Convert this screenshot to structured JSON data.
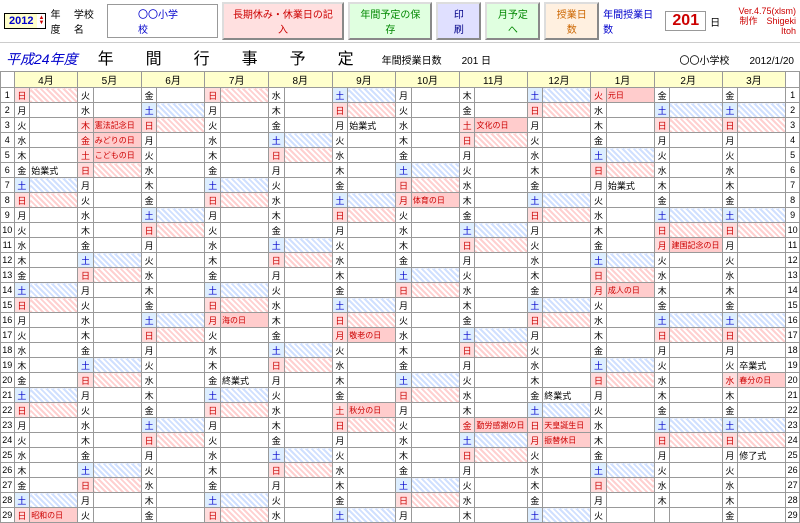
{
  "toolbar": {
    "year": "2012",
    "year_suffix": "年度",
    "school_lbl": "学校名",
    "school": "〇〇小学校",
    "b1": "長期休み・休業日の記入",
    "b2": "年間予定の保存",
    "b3": "印　刷",
    "b4": "月予定へ",
    "b5": "授業日数",
    "days_lbl": "年間授業日数",
    "days": "201",
    "days_unit": "日"
  },
  "ver": {
    "v": "Ver.4.75(xlsm)",
    "author": "制作　Shigeki Itoh"
  },
  "title": {
    "era": "平成24年度",
    "main": "年　間　行　事　予　定",
    "sub_lbl": "年間授業日数",
    "sub_val": "201 日",
    "school": "〇〇小学校",
    "date": "2012/1/20"
  },
  "months": [
    "4月",
    "5月",
    "6月",
    "7月",
    "8月",
    "9月",
    "10月",
    "11月",
    "12月",
    "1月",
    "2月",
    "3月"
  ],
  "dow_chars": {
    "sun": "日",
    "mon": "月",
    "tue": "火",
    "wed": "水",
    "thu": "木",
    "fri": "金",
    "sat": "土"
  },
  "events": {
    "shigyou": "始業式",
    "shuugyou": "終業式",
    "sotsugyou": "卒業式",
    "shuuryou": "修了式",
    "kenpou": "憲法記念日",
    "midori": "みどりの日",
    "kodomo": "こどもの日",
    "showa": "昭和の日",
    "umi": "海の日",
    "keirou": "敬老の日",
    "shuubun": "秋分の日",
    "taiiku": "体育の日",
    "bunka": "文化の日",
    "kinrou": "勤労感謝の日",
    "tennou": "天皇誕生日",
    "furikae": "振替休日",
    "gantan": "元日",
    "seijin": "成人の日",
    "kenkoku": "建国記念の日",
    "shunbun": "春分の日"
  },
  "cal": [
    [
      [
        "日",
        "s"
      ],
      [
        "火"
      ],
      [
        "金"
      ],
      [
        "日",
        "s"
      ],
      [
        "水"
      ],
      [
        "土",
        "b"
      ],
      [
        "月"
      ],
      [
        "木"
      ],
      [
        "土",
        "b"
      ],
      [
        "火",
        "h",
        "gantan"
      ],
      [
        "金"
      ],
      [
        "金"
      ]
    ],
    [
      [
        "月"
      ],
      [
        "水"
      ],
      [
        "土",
        "b"
      ],
      [
        "月"
      ],
      [
        "木"
      ],
      [
        "日",
        "s"
      ],
      [
        "火"
      ],
      [
        "金"
      ],
      [
        "日",
        "s"
      ],
      [
        "水"
      ],
      [
        "土",
        "b"
      ],
      [
        "土",
        "b"
      ]
    ],
    [
      [
        "火"
      ],
      [
        "木",
        "h",
        "kenpou"
      ],
      [
        "日",
        "s"
      ],
      [
        "火"
      ],
      [
        "金"
      ],
      [
        "月",
        "",
        "shigyou"
      ],
      [
        "水"
      ],
      [
        "土",
        "h",
        "bunka"
      ],
      [
        "月"
      ],
      [
        "木"
      ],
      [
        "日",
        "s"
      ],
      [
        "日",
        "s"
      ]
    ],
    [
      [
        "水"
      ],
      [
        "金",
        "h",
        "midori"
      ],
      [
        "月"
      ],
      [
        "水"
      ],
      [
        "土",
        "b"
      ],
      [
        "火"
      ],
      [
        "木"
      ],
      [
        "日",
        "s"
      ],
      [
        "火"
      ],
      [
        "金"
      ],
      [
        "月"
      ],
      [
        "月"
      ]
    ],
    [
      [
        "木"
      ],
      [
        "土",
        "h",
        "kodomo"
      ],
      [
        "火"
      ],
      [
        "木"
      ],
      [
        "日",
        "s"
      ],
      [
        "水"
      ],
      [
        "金"
      ],
      [
        "月"
      ],
      [
        "水"
      ],
      [
        "土",
        "b"
      ],
      [
        "火"
      ],
      [
        "火"
      ]
    ],
    [
      [
        "金",
        "",
        "shigyou"
      ],
      [
        "日",
        "s"
      ],
      [
        "水"
      ],
      [
        "金"
      ],
      [
        "月"
      ],
      [
        "木"
      ],
      [
        "土",
        "b"
      ],
      [
        "火"
      ],
      [
        "木"
      ],
      [
        "日",
        "s"
      ],
      [
        "水"
      ],
      [
        "水"
      ]
    ],
    [
      [
        "土",
        "b"
      ],
      [
        "月"
      ],
      [
        "木"
      ],
      [
        "土",
        "b"
      ],
      [
        "火"
      ],
      [
        "金"
      ],
      [
        "日",
        "s"
      ],
      [
        "水"
      ],
      [
        "金"
      ],
      [
        "月",
        "",
        "shigyou"
      ],
      [
        "木"
      ],
      [
        "木"
      ]
    ],
    [
      [
        "日",
        "s"
      ],
      [
        "火"
      ],
      [
        "金"
      ],
      [
        "日",
        "s"
      ],
      [
        "水"
      ],
      [
        "土",
        "b"
      ],
      [
        "月",
        "h",
        "taiiku"
      ],
      [
        "木"
      ],
      [
        "土",
        "b"
      ],
      [
        "火"
      ],
      [
        "金"
      ],
      [
        "金"
      ]
    ],
    [
      [
        "月"
      ],
      [
        "水"
      ],
      [
        "土",
        "b"
      ],
      [
        "月"
      ],
      [
        "木"
      ],
      [
        "日",
        "s"
      ],
      [
        "火"
      ],
      [
        "金"
      ],
      [
        "日",
        "s"
      ],
      [
        "水"
      ],
      [
        "土",
        "b"
      ],
      [
        "土",
        "b"
      ]
    ],
    [
      [
        "火"
      ],
      [
        "木"
      ],
      [
        "日",
        "s"
      ],
      [
        "火"
      ],
      [
        "金"
      ],
      [
        "月"
      ],
      [
        "水"
      ],
      [
        "土",
        "b"
      ],
      [
        "月"
      ],
      [
        "木"
      ],
      [
        "日",
        "s"
      ],
      [
        "日",
        "s"
      ]
    ],
    [
      [
        "水"
      ],
      [
        "金"
      ],
      [
        "月"
      ],
      [
        "水"
      ],
      [
        "土",
        "b"
      ],
      [
        "火"
      ],
      [
        "木"
      ],
      [
        "日",
        "s"
      ],
      [
        "火"
      ],
      [
        "金"
      ],
      [
        "月",
        "h",
        "kenkoku"
      ],
      [
        "月"
      ]
    ],
    [
      [
        "木"
      ],
      [
        "土",
        "b"
      ],
      [
        "火"
      ],
      [
        "木"
      ],
      [
        "日",
        "s"
      ],
      [
        "水"
      ],
      [
        "金"
      ],
      [
        "月"
      ],
      [
        "水"
      ],
      [
        "土",
        "b"
      ],
      [
        "火"
      ],
      [
        "火"
      ]
    ],
    [
      [
        "金"
      ],
      [
        "日",
        "s"
      ],
      [
        "水"
      ],
      [
        "金"
      ],
      [
        "月"
      ],
      [
        "木"
      ],
      [
        "土",
        "b"
      ],
      [
        "火"
      ],
      [
        "木"
      ],
      [
        "日",
        "s"
      ],
      [
        "水"
      ],
      [
        "水"
      ]
    ],
    [
      [
        "土",
        "b"
      ],
      [
        "月"
      ],
      [
        "木"
      ],
      [
        "土",
        "b"
      ],
      [
        "火"
      ],
      [
        "金"
      ],
      [
        "日",
        "s"
      ],
      [
        "水"
      ],
      [
        "金"
      ],
      [
        "月",
        "h",
        "seijin"
      ],
      [
        "木"
      ],
      [
        "木"
      ]
    ],
    [
      [
        "日",
        "s"
      ],
      [
        "火"
      ],
      [
        "金"
      ],
      [
        "日",
        "s"
      ],
      [
        "水"
      ],
      [
        "土",
        "b"
      ],
      [
        "月"
      ],
      [
        "木"
      ],
      [
        "土",
        "b"
      ],
      [
        "火"
      ],
      [
        "金"
      ],
      [
        "金"
      ]
    ],
    [
      [
        "月"
      ],
      [
        "水"
      ],
      [
        "土",
        "b"
      ],
      [
        "月",
        "h",
        "umi"
      ],
      [
        "木"
      ],
      [
        "日",
        "s"
      ],
      [
        "火"
      ],
      [
        "金"
      ],
      [
        "日",
        "s"
      ],
      [
        "水"
      ],
      [
        "土",
        "b"
      ],
      [
        "土",
        "b"
      ]
    ],
    [
      [
        "火"
      ],
      [
        "木"
      ],
      [
        "日",
        "s"
      ],
      [
        "火"
      ],
      [
        "金"
      ],
      [
        "月",
        "h",
        "keirou"
      ],
      [
        "水"
      ],
      [
        "土",
        "b"
      ],
      [
        "月"
      ],
      [
        "木"
      ],
      [
        "日",
        "s"
      ],
      [
        "日",
        "s"
      ]
    ],
    [
      [
        "水"
      ],
      [
        "金"
      ],
      [
        "月"
      ],
      [
        "水"
      ],
      [
        "土",
        "b"
      ],
      [
        "火"
      ],
      [
        "木"
      ],
      [
        "日",
        "s"
      ],
      [
        "火"
      ],
      [
        "金"
      ],
      [
        "月"
      ],
      [
        "月"
      ]
    ],
    [
      [
        "木"
      ],
      [
        "土",
        "b"
      ],
      [
        "火"
      ],
      [
        "木"
      ],
      [
        "日",
        "s"
      ],
      [
        "水"
      ],
      [
        "金"
      ],
      [
        "月"
      ],
      [
        "水"
      ],
      [
        "土",
        "b"
      ],
      [
        "火"
      ],
      [
        "火",
        "",
        "sotsugyou"
      ]
    ],
    [
      [
        "金"
      ],
      [
        "日",
        "s"
      ],
      [
        "水"
      ],
      [
        "金",
        "",
        "shuugyou"
      ],
      [
        "月"
      ],
      [
        "木"
      ],
      [
        "土",
        "b"
      ],
      [
        "火"
      ],
      [
        "木"
      ],
      [
        "日",
        "s"
      ],
      [
        "水"
      ],
      [
        "水",
        "h",
        "shunbun"
      ]
    ],
    [
      [
        "土",
        "b"
      ],
      [
        "月"
      ],
      [
        "木"
      ],
      [
        "土",
        "b"
      ],
      [
        "火"
      ],
      [
        "金"
      ],
      [
        "日",
        "s"
      ],
      [
        "水"
      ],
      [
        "金",
        "",
        "shuugyou"
      ],
      [
        "月"
      ],
      [
        "木"
      ],
      [
        "木"
      ]
    ],
    [
      [
        "日",
        "s"
      ],
      [
        "火"
      ],
      [
        "金"
      ],
      [
        "日",
        "s"
      ],
      [
        "水"
      ],
      [
        "土",
        "h",
        "shuubun"
      ],
      [
        "月"
      ],
      [
        "木"
      ],
      [
        "土",
        "b"
      ],
      [
        "火"
      ],
      [
        "金"
      ],
      [
        "金"
      ]
    ],
    [
      [
        "月"
      ],
      [
        "水"
      ],
      [
        "土",
        "b"
      ],
      [
        "月"
      ],
      [
        "木"
      ],
      [
        "日",
        "s"
      ],
      [
        "火"
      ],
      [
        "金",
        "h",
        "kinrou"
      ],
      [
        "日",
        "h",
        "tennou"
      ],
      [
        "水"
      ],
      [
        "土",
        "b"
      ],
      [
        "土",
        "b"
      ]
    ],
    [
      [
        "火"
      ],
      [
        "木"
      ],
      [
        "日",
        "s"
      ],
      [
        "火"
      ],
      [
        "金"
      ],
      [
        "月"
      ],
      [
        "水"
      ],
      [
        "土",
        "b"
      ],
      [
        "月",
        "h",
        "furikae"
      ],
      [
        "木"
      ],
      [
        "日",
        "s"
      ],
      [
        "日",
        "s"
      ]
    ],
    [
      [
        "水"
      ],
      [
        "金"
      ],
      [
        "月"
      ],
      [
        "水"
      ],
      [
        "土",
        "b"
      ],
      [
        "火"
      ],
      [
        "木"
      ],
      [
        "日",
        "s"
      ],
      [
        "火"
      ],
      [
        "金"
      ],
      [
        "月"
      ],
      [
        "月",
        "",
        "shuuryou"
      ]
    ],
    [
      [
        "木"
      ],
      [
        "土",
        "b"
      ],
      [
        "火"
      ],
      [
        "木"
      ],
      [
        "日",
        "s"
      ],
      [
        "水"
      ],
      [
        "金"
      ],
      [
        "月"
      ],
      [
        "水"
      ],
      [
        "土",
        "b"
      ],
      [
        "火"
      ],
      [
        "火"
      ]
    ],
    [
      [
        "金"
      ],
      [
        "日",
        "s"
      ],
      [
        "水"
      ],
      [
        "金"
      ],
      [
        "月"
      ],
      [
        "木"
      ],
      [
        "土",
        "b"
      ],
      [
        "火"
      ],
      [
        "木"
      ],
      [
        "日",
        "s"
      ],
      [
        "水"
      ],
      [
        "水"
      ]
    ],
    [
      [
        "土",
        "b"
      ],
      [
        "月"
      ],
      [
        "木"
      ],
      [
        "土",
        "b"
      ],
      [
        "火"
      ],
      [
        "金"
      ],
      [
        "日",
        "s"
      ],
      [
        "水"
      ],
      [
        "金"
      ],
      [
        "月"
      ],
      [
        "木"
      ],
      [
        "木"
      ]
    ],
    [
      [
        "日",
        "h",
        "showa"
      ],
      [
        "火"
      ],
      [
        "金"
      ],
      [
        "日",
        "s"
      ],
      [
        "水"
      ],
      [
        "土",
        "b"
      ],
      [
        "月"
      ],
      [
        "木"
      ],
      [
        "土",
        "b"
      ],
      [
        "火"
      ],
      [
        ""
      ],
      [
        "金"
      ]
    ]
  ]
}
